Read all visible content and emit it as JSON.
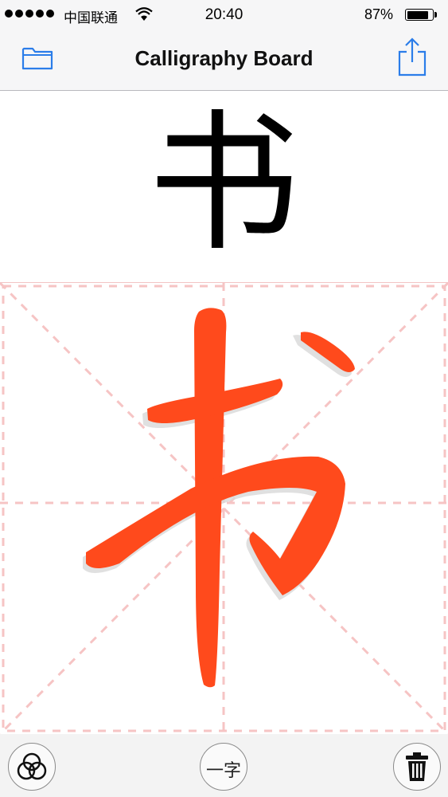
{
  "status_bar": {
    "carrier": "中国联通",
    "time": "20:40",
    "battery_percent_text": "87%",
    "battery_level": 0.87
  },
  "nav": {
    "title": "Calligraphy Board",
    "left_icon": "folder-icon",
    "right_icon": "share-icon",
    "accent_color": "#2b7de9"
  },
  "reference": {
    "character": "书",
    "color": "#000000"
  },
  "board": {
    "guide": "米字格 dashed guide lines",
    "guide_color": "#f6c4c4",
    "stroke_color": "#ff4a1c",
    "character": "书"
  },
  "toolbar": {
    "left_icon": "rings-icon",
    "center_label": "一字",
    "right_icon": "trash-icon"
  }
}
